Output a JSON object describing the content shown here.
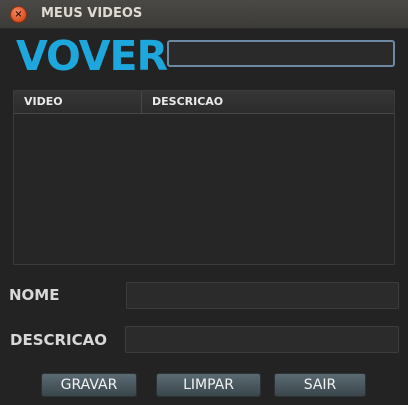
{
  "window": {
    "title": "MEUS VIDEOS"
  },
  "header": {
    "logo_text": "VOVER",
    "search_value": ""
  },
  "table": {
    "columns": [
      "VIDEO",
      "DESCRICAO"
    ],
    "rows": []
  },
  "form": {
    "nome_label": "NOME",
    "nome_value": "",
    "descricao_label": "DESCRICAO",
    "descricao_value": ""
  },
  "buttons": {
    "gravar": "GRAVAR",
    "limpar": "LIMPAR",
    "sair": "SAIR"
  },
  "colors": {
    "logo": "#1ea7dc",
    "background": "#232323",
    "button": "#4a585e"
  }
}
